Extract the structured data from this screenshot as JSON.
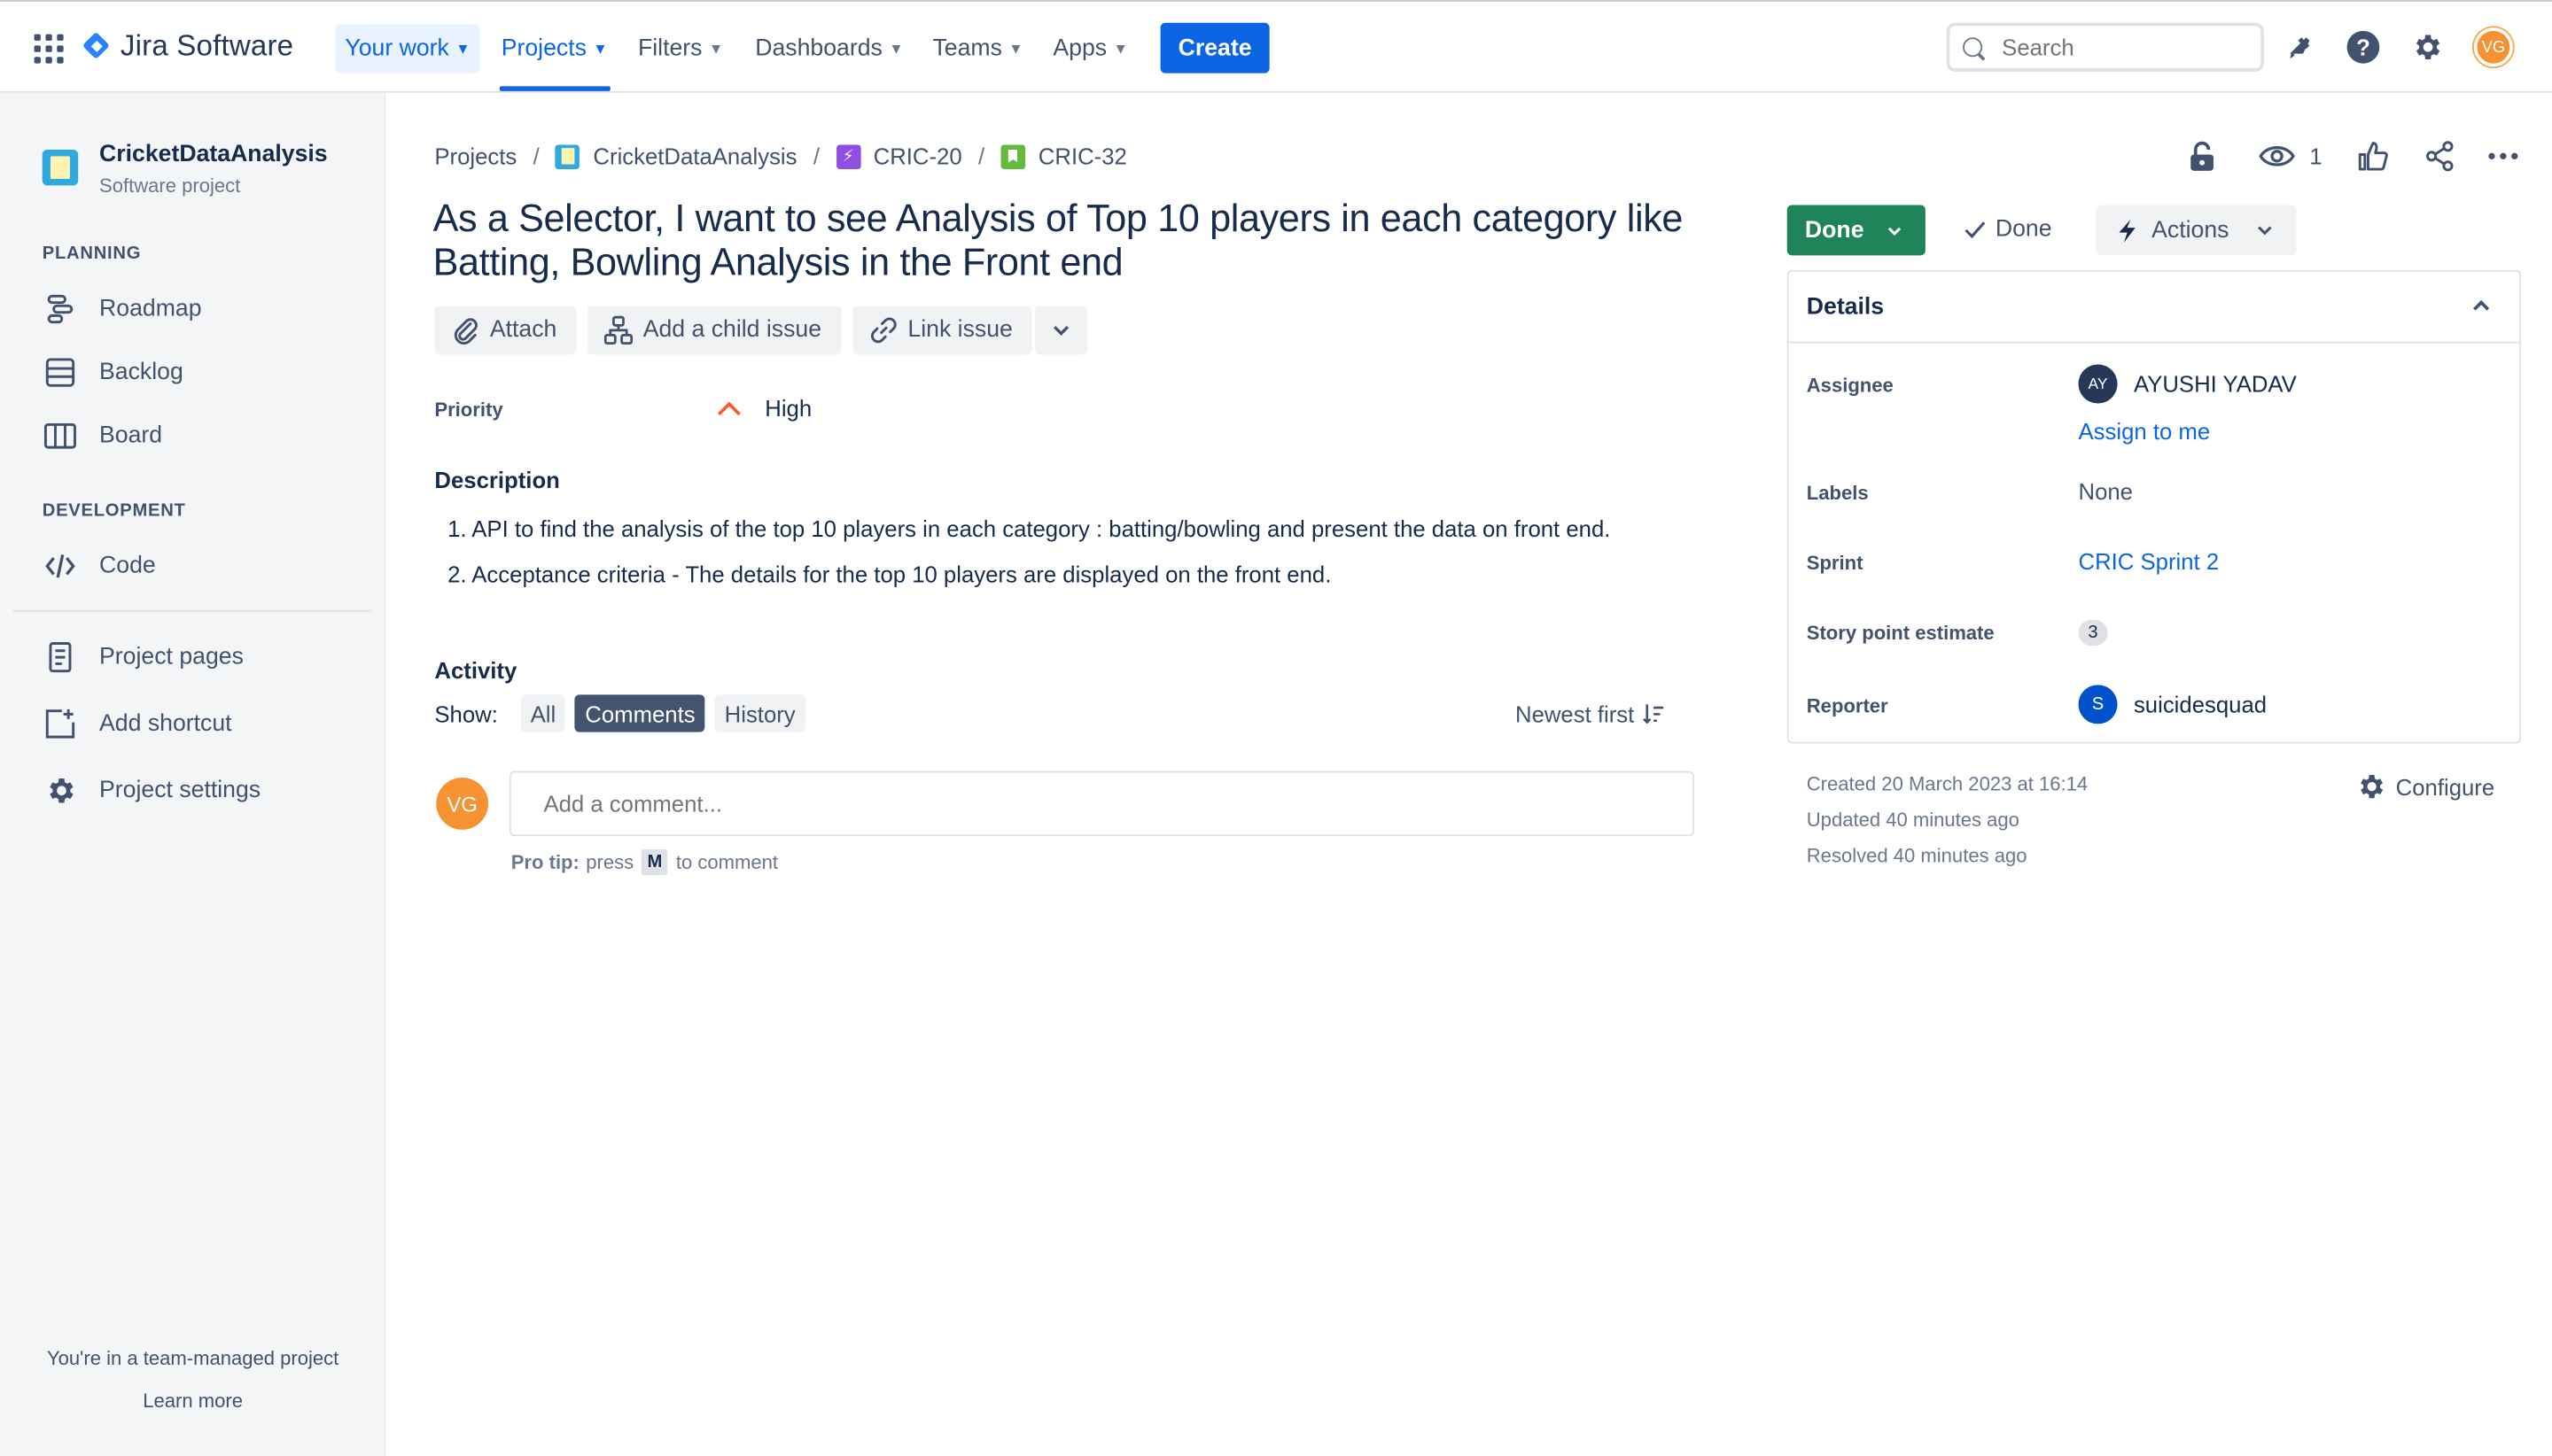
{
  "topnav": {
    "logo_text": "Jira Software",
    "items": [
      {
        "label": "Your work"
      },
      {
        "label": "Projects"
      },
      {
        "label": "Filters"
      },
      {
        "label": "Dashboards"
      },
      {
        "label": "Teams"
      },
      {
        "label": "Apps"
      }
    ],
    "create_label": "Create",
    "search_placeholder": "Search",
    "user_initials": "VG"
  },
  "sidebar": {
    "project_name": "CricketDataAnalysis",
    "project_type": "Software project",
    "planning_header": "PLANNING",
    "planning_items": [
      {
        "label": "Roadmap",
        "icon": "roadmap-icon"
      },
      {
        "label": "Backlog",
        "icon": "backlog-icon"
      },
      {
        "label": "Board",
        "icon": "board-icon"
      }
    ],
    "development_header": "DEVELOPMENT",
    "development_items": [
      {
        "label": "Code",
        "icon": "code-icon"
      }
    ],
    "other_items": [
      {
        "label": "Project pages",
        "icon": "page-icon"
      },
      {
        "label": "Add shortcut",
        "icon": "add-shortcut-icon"
      },
      {
        "label": "Project settings",
        "icon": "gear-icon"
      }
    ],
    "footer_text": "You're in a team-managed project",
    "footer_link": "Learn more"
  },
  "breadcrumb": {
    "items": [
      "Projects",
      "CricketDataAnalysis",
      "CRIC-20",
      "CRIC-32"
    ],
    "separator": "/"
  },
  "header_actions": {
    "watch_count": "1"
  },
  "issue": {
    "title": "As a Selector, I want to see Analysis of Top 10 players in each category like Batting, Bowling Analysis in the Front end",
    "buttons": {
      "attach": "Attach",
      "add_child": "Add a child issue",
      "link_issue": "Link issue"
    },
    "priority_label": "Priority",
    "priority_value": "High",
    "description_header": "Description",
    "description_items": [
      "1. API to find the analysis of the top 10 players in each category : batting/bowling and present the data on front end.",
      "2. Acceptance criteria - The details for the top 10 players are displayed on the front end."
    ]
  },
  "activity": {
    "header": "Activity",
    "show_label": "Show:",
    "filters": [
      "All",
      "Comments",
      "History"
    ],
    "active_filter": "Comments",
    "sort_label": "Newest first",
    "commenter_initials": "VG",
    "comment_placeholder": "Add a comment...",
    "pro_tip_bold": "Pro tip:",
    "pro_tip_pre": "press",
    "pro_tip_key": "M",
    "pro_tip_post": "to comment"
  },
  "status": {
    "button_label": "Done",
    "resolution_label": "Done",
    "actions_label": "Actions",
    "status_color": "#1f845a"
  },
  "details": {
    "title": "Details",
    "assignee_label": "Assignee",
    "assignee_initials": "AY",
    "assignee_name": "AYUSHI YADAV",
    "assign_to_me": "Assign to me",
    "labels_label": "Labels",
    "labels_value": "None",
    "sprint_label": "Sprint",
    "sprint_value": "CRIC Sprint 2",
    "story_points_label": "Story point estimate",
    "story_points_value": "3",
    "reporter_label": "Reporter",
    "reporter_initials": "S",
    "reporter_name": "suicidesquad"
  },
  "meta": {
    "created": "Created 20 March 2023 at 16:14",
    "updated": "Updated 40 minutes ago",
    "resolved": "Resolved 40 minutes ago",
    "configure_label": "Configure"
  }
}
